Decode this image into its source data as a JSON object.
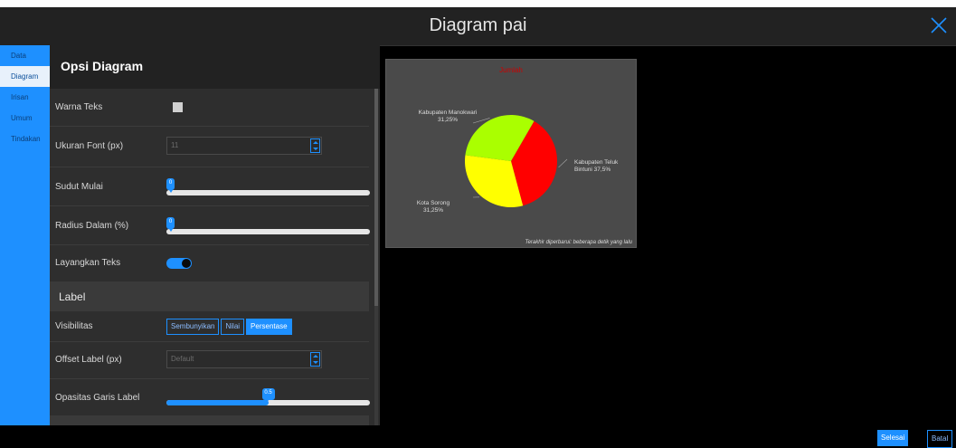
{
  "window": {
    "title": "Diagram pai"
  },
  "sidebar": {
    "tabs": [
      {
        "label": "Data"
      },
      {
        "label": "Diagram"
      },
      {
        "label": "Irisan"
      },
      {
        "label": "Umum"
      },
      {
        "label": "Tindakan"
      }
    ],
    "active_tab": "Diagram"
  },
  "panel": {
    "title": "Opsi Diagram",
    "text_color": {
      "label": "Warna Teks",
      "value": "#d0d0d0"
    },
    "font_size": {
      "label": "Ukuran Font (px)",
      "placeholder": "11"
    },
    "start_angle": {
      "label": "Sudut Mulai",
      "value": "0",
      "fraction": 0
    },
    "inner_radius": {
      "label": "Radius Dalam (%)",
      "value": "0",
      "fraction": 0
    },
    "float_text": {
      "label": "Layangkan Teks",
      "on": true
    },
    "label_section": "Label",
    "visibility": {
      "label": "Visibilitas",
      "options": [
        "Sembunyikan",
        "Nilai",
        "Persentase"
      ],
      "selected": "Persentase"
    },
    "label_offset": {
      "label": "Offset Label (px)",
      "placeholder": "Default"
    },
    "line_opacity": {
      "label": "Opasitas Garis Label",
      "value": "0.5",
      "fraction": 0.5
    }
  },
  "chart_data": {
    "type": "pie",
    "title": "Jumlah",
    "slices": [
      {
        "label": "Kabupaten Teluk Bintuni",
        "percent": 37.5,
        "display": "Kabupaten Teluk Bintuni 37,5%",
        "color": "#ff0000"
      },
      {
        "label": "Kota Sorong",
        "percent": 31.25,
        "display": "Kota Sorong 31,25%",
        "color": "#ffff00"
      },
      {
        "label": "Kabupaten Manokwari",
        "percent": 31.25,
        "display": "Kabupaten Manokwari 31,25%",
        "color": "#aaff00"
      }
    ],
    "footnote": "Terakhir diperbarui: beberapa detik yang lalu"
  },
  "footer": {
    "done": "Selesai",
    "cancel": "Batal"
  },
  "colors": {
    "accent": "#1e90ff",
    "panel": "#2e2e2e",
    "background": "#000000"
  }
}
